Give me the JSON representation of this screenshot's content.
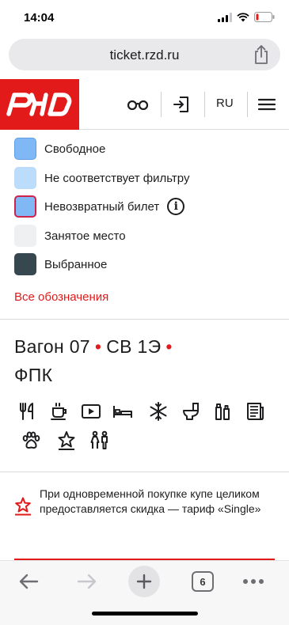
{
  "status_bar": {
    "time": "14:04"
  },
  "browser": {
    "url": "ticket.rzd.ru",
    "tab_count": "6"
  },
  "header": {
    "lang": "RU"
  },
  "colors": {
    "brand_red": "#e21a1a",
    "free": "#7fb8f5",
    "not_matching": "#bcdcfb",
    "occupied": "#eef0f1",
    "selected": "#37474f"
  },
  "legend": {
    "items": [
      {
        "label": "Свободное"
      },
      {
        "label": "Не соответствует фильтру"
      },
      {
        "label": "Невозвратный билет"
      },
      {
        "label": "Занятое место"
      },
      {
        "label": "Выбранное"
      }
    ],
    "all_link": "Все обозначения"
  },
  "wagon": {
    "number": "Вагон 07",
    "class": "СВ 1Э",
    "carrier": "ФПК",
    "amenities": [
      "restaurant-icon",
      "coffee-icon",
      "video-icon",
      "bed-icon",
      "air-conditioning-icon",
      "toilet-icon",
      "hygiene-kit-icon",
      "press-icon",
      "pets-icon",
      "star-service-icon",
      "family-icon"
    ]
  },
  "promo": {
    "text": "При одновременной покупке купе целиком предоставляется скидка — тариф «Single»"
  }
}
